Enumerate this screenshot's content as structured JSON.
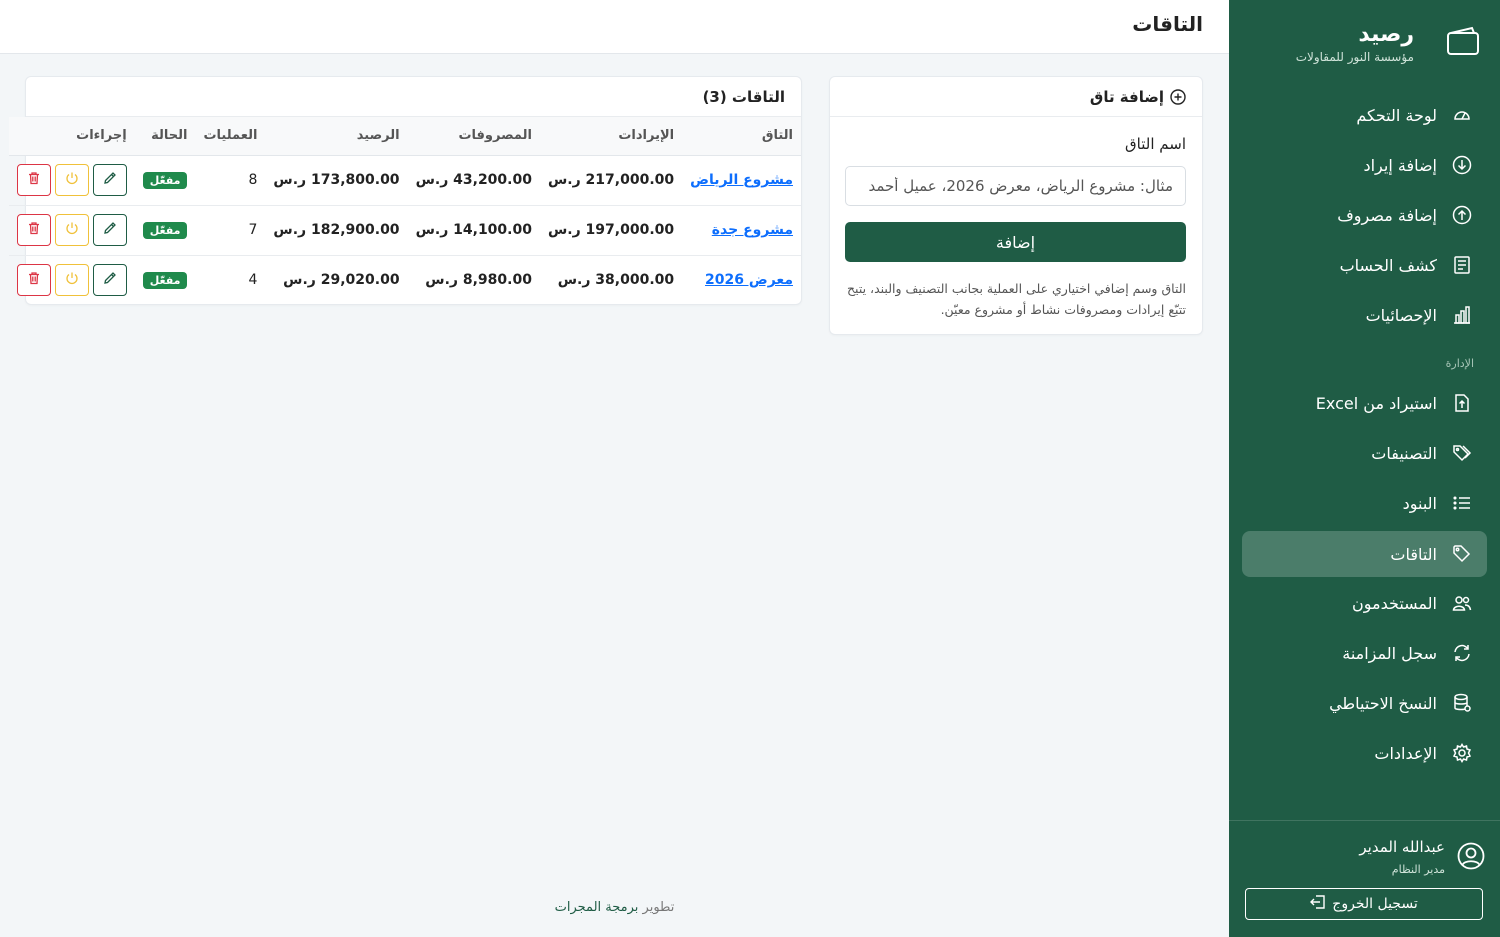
{
  "brand": {
    "title": "رصيد",
    "subtitle": "مؤسسة النور للمقاولات"
  },
  "sidebar": {
    "items": [
      {
        "label": "لوحة التحكم",
        "icon": "dashboard-gauge-icon"
      },
      {
        "label": "إضافة إيراد",
        "icon": "arrow-down-circle-icon"
      },
      {
        "label": "إضافة مصروف",
        "icon": "arrow-up-circle-icon"
      },
      {
        "label": "كشف الحساب",
        "icon": "document-list-icon"
      },
      {
        "label": "الإحصائيات",
        "icon": "bar-chart-icon"
      },
      {
        "label": "استيراد من Excel",
        "icon": "file-upload-icon"
      },
      {
        "label": "التصنيفات",
        "icon": "tags-icon"
      },
      {
        "label": "البنود",
        "icon": "list-icon"
      },
      {
        "label": "التاقات",
        "icon": "tag-icon",
        "active": true
      },
      {
        "label": "المستخدمون",
        "icon": "users-icon"
      },
      {
        "label": "سجل المزامنة",
        "icon": "sync-icon"
      },
      {
        "label": "النسخ الاحتياطي",
        "icon": "database-icon"
      },
      {
        "label": "الإعدادات",
        "icon": "gear-icon"
      }
    ],
    "section_admin": "الإدارة"
  },
  "user": {
    "name": "عبدالله المدير",
    "role": "مدير النظام",
    "logout": "تسجيل الخروج"
  },
  "header": {
    "title": "التاقات"
  },
  "add_tag": {
    "title": "إضافة تاق",
    "field_label": "اسم التاق",
    "placeholder": "مثال: مشروع الرياض، معرض 2026، عميل أحمد",
    "submit": "إضافة",
    "help": "التاق وسم إضافي اختياري على العملية بجانب التصنيف والبند، يتيح تتبّع إيرادات ومصروفات نشاط أو مشروع معيّن."
  },
  "tags_table": {
    "title": "التاقات (3)",
    "columns": [
      "التاق",
      "الإيرادات",
      "المصروفات",
      "الرصيد",
      "العمليات",
      "الحالة",
      "إجراءات"
    ],
    "rows": [
      {
        "tag": "مشروع الرياض",
        "income": "217,000.00 ر.س",
        "expenses": "43,200.00 ر.س",
        "balance": "173,800.00 ر.س",
        "count": "8",
        "status": "مفعّل"
      },
      {
        "tag": "مشروع جدة",
        "income": "197,000.00 ر.س",
        "expenses": "14,100.00 ر.س",
        "balance": "182,900.00 ر.س",
        "count": "7",
        "status": "مفعّل"
      },
      {
        "tag": "معرض 2026",
        "income": "38,000.00 ر.س",
        "expenses": "8,980.00 ر.س",
        "balance": "29,020.00 ر.س",
        "count": "4",
        "status": "مفعّل"
      }
    ]
  },
  "footer": {
    "prefix": "تطوير",
    "developer": "برمجة المجرات"
  },
  "colors": {
    "primary": "#1f5c45",
    "active_item": "#4b7d6a",
    "badge": "#1f8a4c",
    "link": "#0d6efd",
    "delete": "#dc3545",
    "toggle": "#f0c13a"
  }
}
